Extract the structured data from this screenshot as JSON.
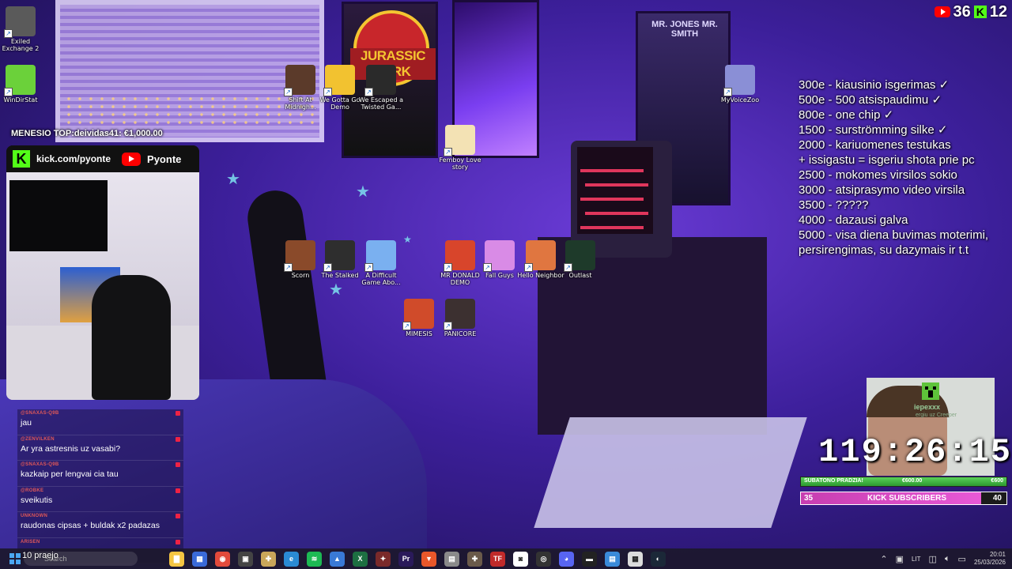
{
  "counter": {
    "youtube": "36",
    "kick": "12"
  },
  "top_donor": "MENESIO TOP:deividas41: €1,000.00",
  "cam_overlay": {
    "kick_url": "kick.com/pyonte",
    "youtube_name": "Pyonte"
  },
  "goals": [
    "300e - kiausinio isgerimas ✓",
    "500e - 500 atsispaudimu ✓",
    "800e - one chip ✓",
    "1500 - surströmming silke ✓",
    "2000 - kariuomenes testukas",
    "+ issigastu = isgeriu shota prie pc",
    "2500 - mokomes virsilos sokio",
    "3000 - atsiprasymo video virsila",
    "3500 - ?????",
    "4000 - dazausi galva",
    "5000 - visa diena buvimas moterimi, persirengimas, su dazymais ir t.t"
  ],
  "desktop_icons": [
    {
      "label": "Exiled Exchange 2",
      "color": "#5a5a5a"
    },
    {
      "label": "WinDirStat",
      "color": "#6bd13a"
    },
    {
      "label": "Shift At Midnigh...",
      "color": "#5b3a2a"
    },
    {
      "label": "We Gotta Go Demo",
      "color": "#f2c230"
    },
    {
      "label": "We Escaped a Twisted Ga...",
      "color": "#2a2a2a"
    },
    {
      "label": "MyVoiceZoo",
      "color": "#8a8fd6"
    },
    {
      "label": "Femboy Love story",
      "color": "#f3e2b4"
    },
    {
      "label": "Scorn",
      "color": "#8a4a2a"
    },
    {
      "label": "The Stalked",
      "color": "#2e2e2e"
    },
    {
      "label": "A Difficult Game Abo...",
      "color": "#7ab0f0"
    },
    {
      "label": "MR DONALD DEMO",
      "color": "#d8452b"
    },
    {
      "label": "Fall Guys",
      "color": "#d98be6"
    },
    {
      "label": "Hello Neighbor",
      "color": "#e07640"
    },
    {
      "label": "Outlast",
      "color": "#1e3a2a"
    },
    {
      "label": "MIMESIS",
      "color": "#d04b2a"
    },
    {
      "label": "PANICORE",
      "color": "#3c3030"
    }
  ],
  "posters": {
    "jurassic": "JURASSIC PARK",
    "mib": "MR. JONES  MR. SMITH"
  },
  "chat": [
    {
      "user": "@SNAXAS-Q9B",
      "text": "jau"
    },
    {
      "user": "@ZENVILKEN",
      "text": "Ar yra astresnis uz vasabi?"
    },
    {
      "user": "@SNAXAS-Q9B",
      "text": "kazkaip per lengvai cia tau"
    },
    {
      "user": "@ROBKE",
      "text": "sveikutis"
    },
    {
      "user": "UNKNOWN",
      "text": "raudonas cipsas + buldak x2 padazas"
    },
    {
      "user": "ARISEN",
      "text": "10 praejo"
    }
  ],
  "mini_cam": {
    "name": "iepexxx",
    "sub": "ergiu uz Creeper"
  },
  "timer": "119:26:15",
  "progress_goal": {
    "left": "SUBATONO PRADZIA!",
    "middle": "€600.00",
    "right": "€600",
    "fraction": 1.0
  },
  "subs_goal": {
    "current": "35",
    "label": "KICK SUBSCRIBERS",
    "target": "40",
    "fraction": 0.875
  },
  "taskbar": {
    "search_placeholder": "Search",
    "icons": [
      {
        "name": "file-explorer-icon",
        "color": "#f4c542",
        "glyph": "▇"
      },
      {
        "name": "widgets-icon",
        "color": "#3a6ad9",
        "glyph": "▦"
      },
      {
        "name": "chrome-icon",
        "color": "#e24a3b",
        "glyph": "◉"
      },
      {
        "name": "app-icon-1",
        "color": "#444",
        "glyph": "▣"
      },
      {
        "name": "app-icon-2",
        "color": "#c9a65a",
        "glyph": "✚"
      },
      {
        "name": "edge-icon",
        "color": "#2a8ad4",
        "glyph": "e"
      },
      {
        "name": "spotify-icon",
        "color": "#1db954",
        "glyph": "≋"
      },
      {
        "name": "photos-icon",
        "color": "#3979d6",
        "glyph": "▲"
      },
      {
        "name": "excel-icon",
        "color": "#1d6f42",
        "glyph": "X"
      },
      {
        "name": "app-icon-3",
        "color": "#7a2a2a",
        "glyph": "✦"
      },
      {
        "name": "premiere-icon",
        "color": "#2a1a5a",
        "glyph": "Pr"
      },
      {
        "name": "brave-icon",
        "color": "#e9572a",
        "glyph": "▼"
      },
      {
        "name": "app-icon-4",
        "color": "#8a8a8a",
        "glyph": "▤"
      },
      {
        "name": "app-icon-5",
        "color": "#6a5a4a",
        "glyph": "✚"
      },
      {
        "name": "tf-icon",
        "color": "#c02a2a",
        "glyph": "TF"
      },
      {
        "name": "camera-icon",
        "color": "#fff",
        "glyph": "◙"
      },
      {
        "name": "obs-icon",
        "color": "#333",
        "glyph": "◎"
      },
      {
        "name": "discord-icon",
        "color": "#5865f2",
        "glyph": "◕"
      },
      {
        "name": "terminal-icon",
        "color": "#222",
        "glyph": "▬"
      },
      {
        "name": "notepad-icon",
        "color": "#3a8ad9",
        "glyph": "▤"
      },
      {
        "name": "app-icon-6",
        "color": "#dcdcdc",
        "glyph": "▦"
      },
      {
        "name": "steam-icon",
        "color": "#1b2838",
        "glyph": "◐"
      }
    ],
    "language": "LIT",
    "time": "20:01",
    "date": "25/03/2026"
  }
}
